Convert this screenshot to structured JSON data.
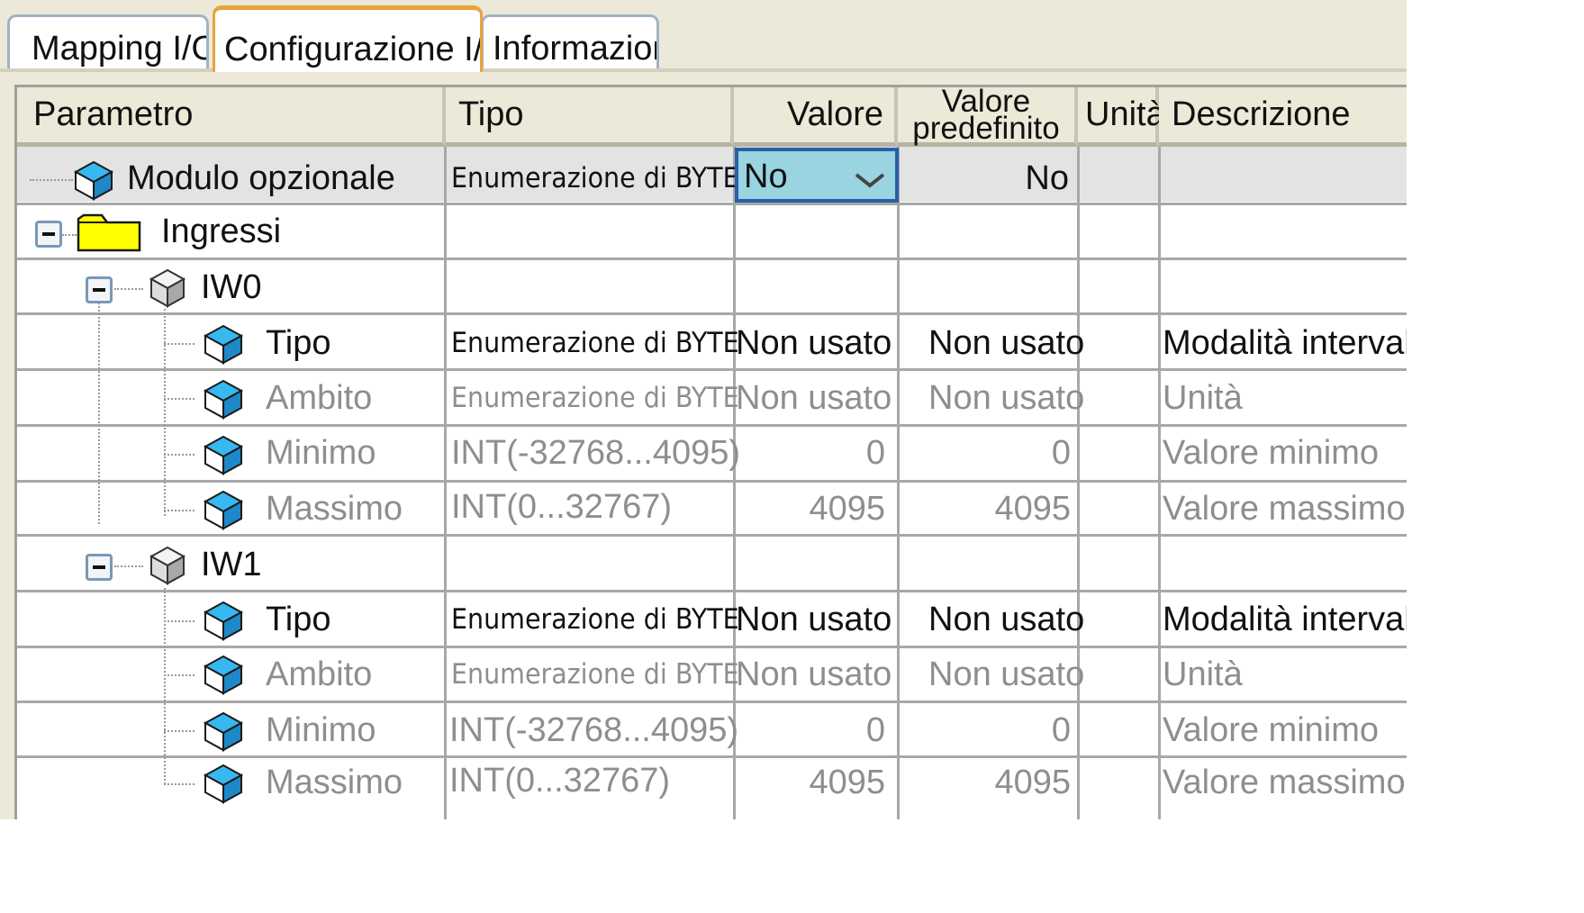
{
  "tabs": [
    {
      "label": "Mapping I/O",
      "active": false
    },
    {
      "label": "Configurazione I/O",
      "active": true
    },
    {
      "label": "Informazioni",
      "active": false
    }
  ],
  "columns": {
    "parametro": "Parametro",
    "tipo": "Tipo",
    "valore": "Valore",
    "predefinito_1": "Valore",
    "predefinito_2": "predefinito",
    "unita": "Unità",
    "descrizione": "Descrizione"
  },
  "rows": {
    "modulo": {
      "name": "Modulo opzionale",
      "type": "Enumerazione di BYTE",
      "value": "No",
      "default": "No"
    },
    "ingressi": {
      "name": "Ingressi"
    },
    "iw0": {
      "name": "IW0",
      "tipo": {
        "name": "Tipo",
        "type": "Enumerazione di BYTE",
        "value": "Non usato",
        "default": "Non usato",
        "desc": "Modalità intervallo"
      },
      "ambito": {
        "name": "Ambito",
        "type": "Enumerazione di BYTE",
        "value": "Non usato",
        "default": "Non usato",
        "desc": "Unità"
      },
      "minimo": {
        "name": "Minimo",
        "type": "INT(-32768...4095)",
        "value": "0",
        "default": "0",
        "desc": "Valore minimo"
      },
      "massimo": {
        "name": "Massimo",
        "type": "INT(0...32767)",
        "value": "4095",
        "default": "4095",
        "desc": "Valore massimo"
      }
    },
    "iw1": {
      "name": "IW1",
      "tipo": {
        "name": "Tipo",
        "type": "Enumerazione di BYTE",
        "value": "Non usato",
        "default": "Non usato",
        "desc": "Modalità intervallo"
      },
      "ambito": {
        "name": "Ambito",
        "type": "Enumerazione di BYTE",
        "value": "Non usato",
        "default": "Non usato",
        "desc": "Unità"
      },
      "minimo": {
        "name": "Minimo",
        "type": "INT(-32768...4095)",
        "value": "0",
        "default": "0",
        "desc": "Valore minimo"
      },
      "massimo": {
        "name": "Massimo",
        "type": "INT(0...32767)",
        "value": "4095",
        "default": "4095",
        "desc": "Valore massimo"
      }
    }
  },
  "colors": {
    "active_tab": "#e8a33c",
    "dropdown_bg": "#99d4e0",
    "dropdown_border": "#2a5fa8",
    "folder": "#ffff00",
    "param_icon": "#1ea0e0",
    "disabled_text": "#8e8e8e"
  },
  "icons": {
    "expander": "minus-box-icon",
    "folder": "folder-icon",
    "parameter": "blue-cube-icon",
    "channel": "gray-cube-icon",
    "dropdown": "chevron-down-icon"
  }
}
